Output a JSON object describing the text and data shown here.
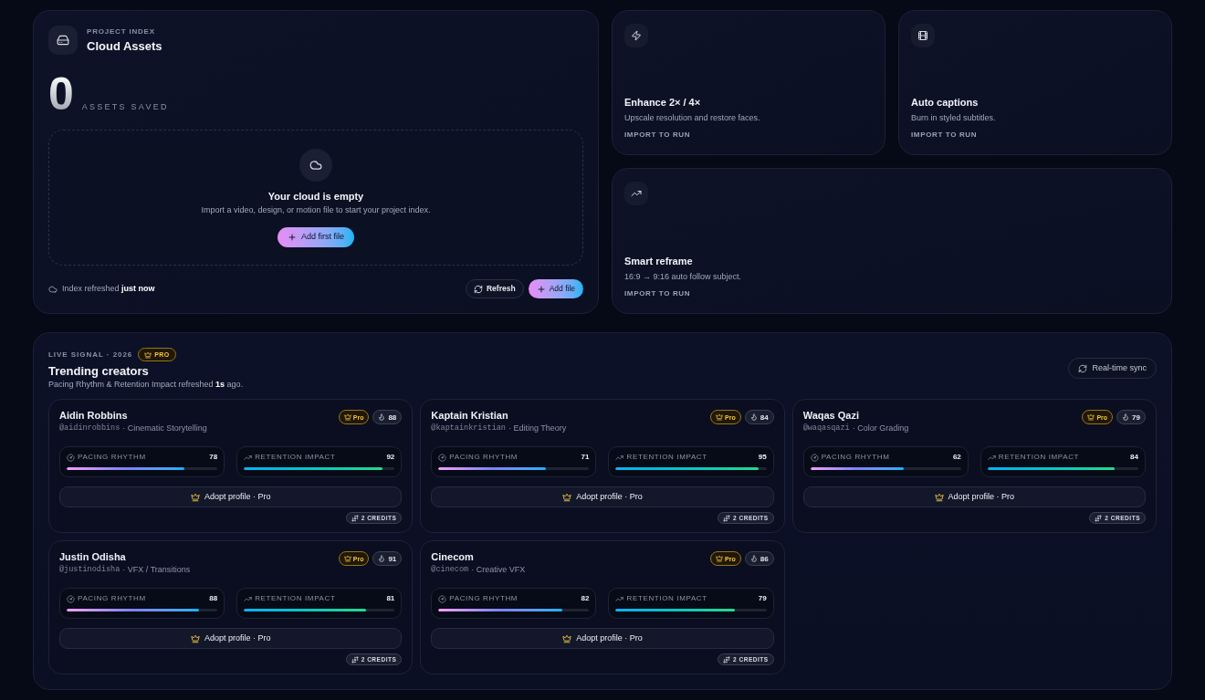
{
  "project_index": {
    "eyebrow": "PROJECT INDEX",
    "title": "Cloud Assets",
    "count": "0",
    "count_label": "ASSETS SAVED",
    "empty_state": {
      "title": "Your cloud is empty",
      "text": "Import a video, design, or motion file to start your project index.",
      "button": "Add first file"
    },
    "footer": {
      "status": "Index refreshed **just now**",
      "buttons": [
        {
          "kind": "refresh",
          "label": "Refresh"
        },
        {
          "kind": "add",
          "label": "Add file"
        }
      ]
    }
  },
  "tools": [
    {
      "kind": "bolt",
      "title": "Enhance 2× / 4×",
      "description": "Upscale resolution and restore faces.",
      "action": "IMPORT TO RUN"
    },
    {
      "kind": "film",
      "title": "Auto captions",
      "description": "Burn in styled subtitles.",
      "action": "IMPORT TO RUN"
    },
    {
      "kind": "trend",
      "title": "Smart reframe",
      "description": "16:9 → 9:16 auto follow subject.",
      "action": "IMPORT TO RUN"
    }
  ],
  "trending": {
    "eyebrow": "LIVE SIGNAL · 2026",
    "badge": "PRO",
    "title": "Trending creators",
    "subtitle": "Pacing Rhythm & Retention Impact refreshed **1s** ago.",
    "sync_button": "Real-time sync",
    "creators": [
      {
        "name": "Aidin Robbins",
        "handle": "@aidinrobbins",
        "specialty": "· Cinematic Storytelling",
        "tier": "Pro",
        "score": "88",
        "metrics": [
          {
            "kind": "pacing",
            "label": "PACING RHYTHM",
            "value": "78",
            "level": 0.78
          },
          {
            "kind": "retention",
            "label": "RETENTION IMPACT",
            "value": "92",
            "level": 0.92
          }
        ],
        "button": "Adopt profile · Pro",
        "credits": "2 CREDITS"
      },
      {
        "name": "Kaptain Kristian",
        "handle": "@kaptainkristian",
        "specialty": "· Editing Theory",
        "tier": "Pro",
        "score": "84",
        "metrics": [
          {
            "kind": "pacing",
            "label": "PACING RHYTHM",
            "value": "71",
            "level": 0.71
          },
          {
            "kind": "retention",
            "label": "RETENTION IMPACT",
            "value": "95",
            "level": 0.95
          }
        ],
        "button": "Adopt profile · Pro",
        "credits": "2 CREDITS"
      },
      {
        "name": "Waqas Qazi",
        "handle": "@waqasqazi",
        "specialty": "· Color Grading",
        "tier": "Pro",
        "score": "79",
        "metrics": [
          {
            "kind": "pacing",
            "label": "PACING RHYTHM",
            "value": "62",
            "level": 0.62
          },
          {
            "kind": "retention",
            "label": "RETENTION IMPACT",
            "value": "84",
            "level": 0.84
          }
        ],
        "button": "Adopt profile · Pro",
        "credits": "2 CREDITS"
      },
      {
        "name": "Justin Odisha",
        "handle": "@justinodisha",
        "specialty": "· VFX / Transitions",
        "tier": "Pro",
        "score": "91",
        "metrics": [
          {
            "kind": "pacing",
            "label": "PACING RHYTHM",
            "value": "88",
            "level": 0.88
          },
          {
            "kind": "retention",
            "label": "RETENTION IMPACT",
            "value": "81",
            "level": 0.81
          }
        ],
        "button": "Adopt profile · Pro",
        "credits": "2 CREDITS"
      },
      {
        "name": "Cinecom",
        "handle": "@cinecom",
        "specialty": "· Creative VFX",
        "tier": "Pro",
        "score": "86",
        "metrics": [
          {
            "kind": "pacing",
            "label": "PACING RHYTHM",
            "value": "82",
            "level": 0.82
          },
          {
            "kind": "retention",
            "label": "RETENTION IMPACT",
            "value": "79",
            "level": 0.79
          }
        ],
        "button": "Adopt profile · Pro",
        "credits": "2 CREDITS"
      }
    ]
  }
}
